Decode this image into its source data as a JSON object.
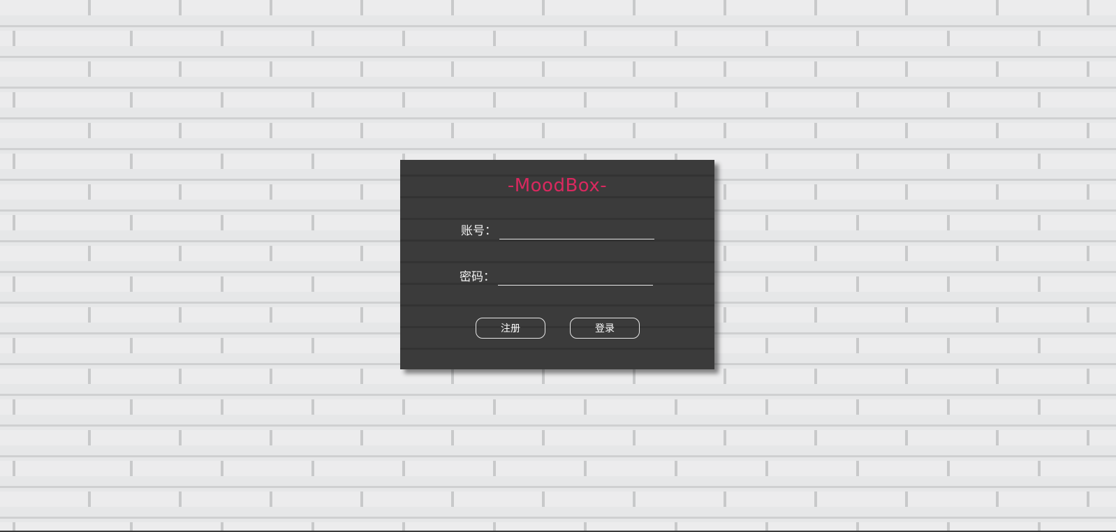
{
  "app": {
    "title": "-MoodBox-"
  },
  "login_form": {
    "account": {
      "label": "账号：",
      "value": ""
    },
    "password": {
      "label": "密码：",
      "value": ""
    },
    "register_label": "注册",
    "login_label": "登录"
  },
  "colors": {
    "title": "#d9295f",
    "card_background": "#3b3b3b",
    "wall_background": "#e6e7e8",
    "text": "#f2f2f2"
  }
}
